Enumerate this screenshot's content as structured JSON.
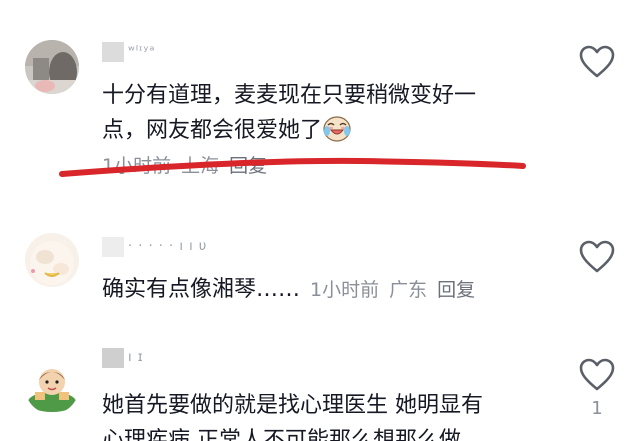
{
  "comments": [
    {
      "username": "ʷᴵᶦʸᵃ",
      "text_line1": "十分有道理，麦麦现在只要稍微变好一",
      "text_line2": "点，网友都会很爱她了",
      "emoji": "crying-laughing-emoji",
      "time": "1小时前",
      "location": "上海",
      "reply": "回复"
    },
    {
      "username": "· ·  · · ·  ı ı υ",
      "text": "确实有点像湘琴……",
      "time": "1小时前",
      "location": "广东",
      "reply": "回复"
    },
    {
      "username": "ı ɪ",
      "text_line1": "她首先要做的就是找心理医生 她明显有",
      "text_line2": "心理疾病 正常人不可能那么想那么做",
      "like_count": "1"
    }
  ],
  "icons": {
    "like": "heart-outline-icon"
  },
  "colors": {
    "annotation_stroke": "#d8262a",
    "meta_text": "#8a8f99",
    "body_text": "#161823"
  }
}
